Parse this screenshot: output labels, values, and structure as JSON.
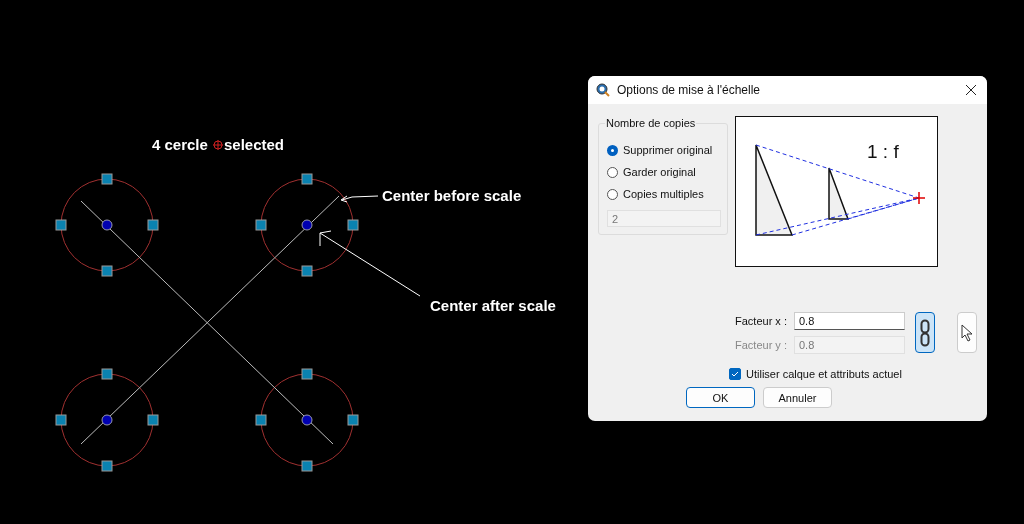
{
  "canvas": {
    "caption": [
      "4 cercle",
      "selected"
    ],
    "annotations": [
      "Center before scale",
      "Center after scale"
    ]
  },
  "dialog": {
    "title": "Options de mise à l'échelle",
    "copies": {
      "title": "Nombre de copies",
      "options": [
        {
          "label": "Supprimer original",
          "selected": true
        },
        {
          "label": "Garder original",
          "selected": false
        },
        {
          "label": "Copies multiples",
          "selected": false
        }
      ],
      "count": {
        "value": "2",
        "disabled": true
      }
    },
    "preview": {
      "ratio": "1 : f"
    },
    "factor_x": {
      "label": "Facteur x :",
      "value": "0.8",
      "disabled": false
    },
    "factor_y": {
      "label": "Facteur y :",
      "value": "0.8",
      "disabled": true
    },
    "lock": {
      "on": true
    },
    "use_layer": {
      "label": "Utiliser calque et attributs actuel",
      "checked": true
    },
    "buttons": [
      "OK",
      "Annuler"
    ]
  }
}
